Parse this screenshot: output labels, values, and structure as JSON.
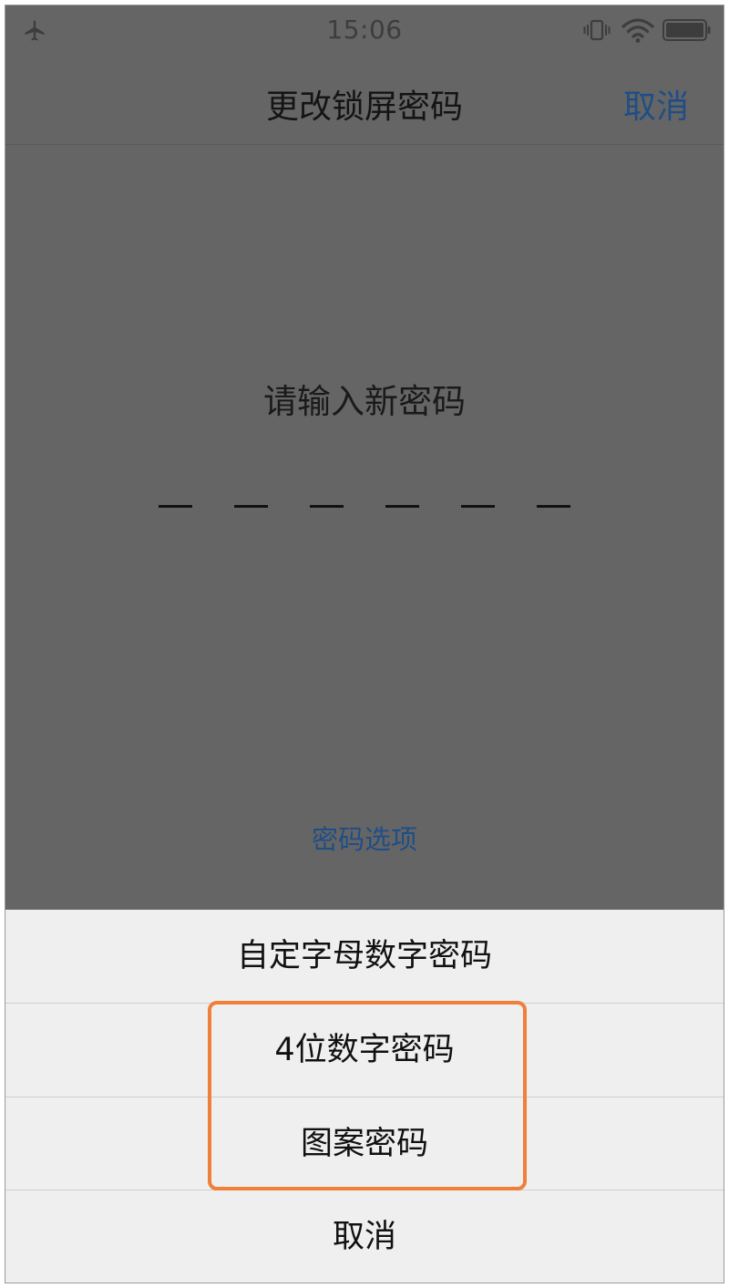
{
  "status_bar": {
    "time": "15:06",
    "icons": [
      "airplane-icon",
      "vibrate-icon",
      "wifi-icon",
      "battery-icon"
    ]
  },
  "nav": {
    "title": "更改锁屏密码",
    "cancel_label": "取消"
  },
  "passcode": {
    "prompt": "请输入新密码",
    "digit_count": 6,
    "options_label": "密码选项"
  },
  "action_sheet": {
    "items": [
      {
        "label": "自定字母数字密码"
      },
      {
        "label": "4位数字密码"
      },
      {
        "label": "图案密码"
      },
      {
        "label": "取消"
      }
    ]
  },
  "colors": {
    "accent": "#1f4e86",
    "overlay": "#656565",
    "sheet_bg": "#efefef",
    "highlight": "#ef7f39"
  }
}
